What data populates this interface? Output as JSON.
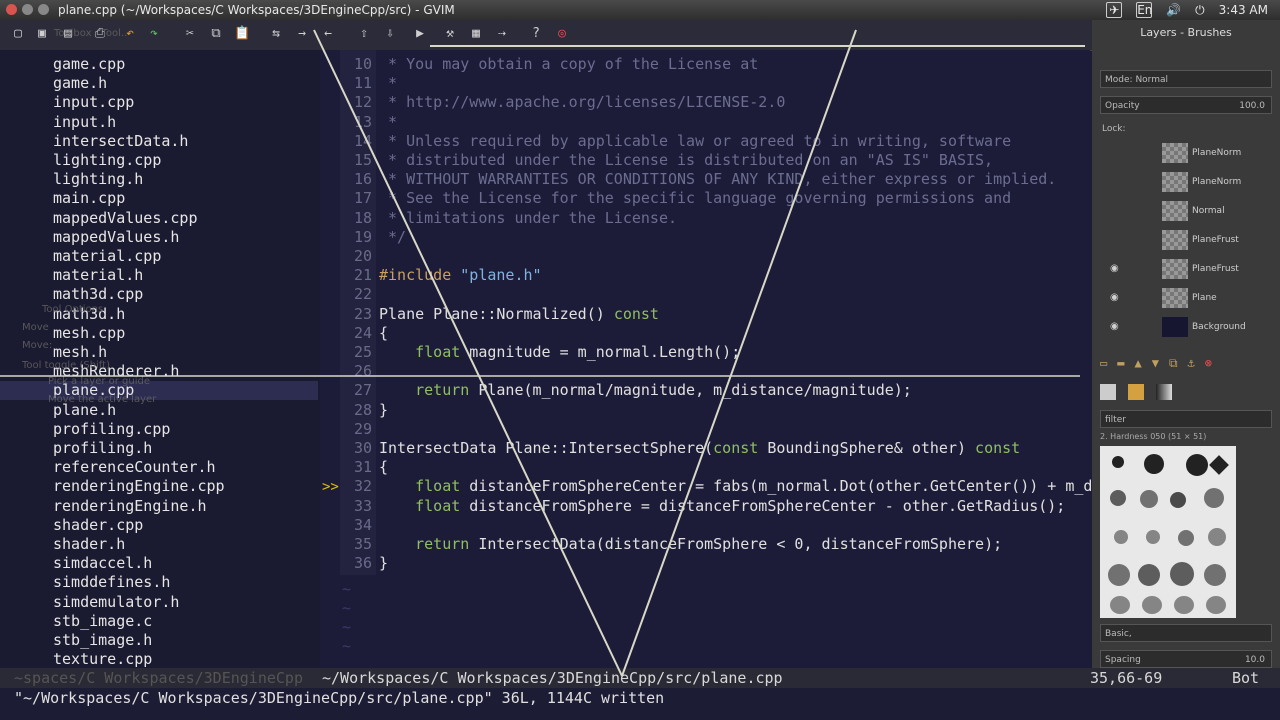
{
  "window": {
    "title": "plane.cpp (~/Workspaces/C Workspaces/3DEngineCpp/src) - GVIM"
  },
  "tray": {
    "lang": "En",
    "time": "3:43 AM"
  },
  "toolbar": {
    "icons": [
      "new-icon",
      "open-icon",
      "save-icon",
      "print-icon",
      "undo-icon",
      "redo-icon",
      "cut-icon",
      "copy-icon",
      "paste-icon",
      "replace-icon",
      "find-next-icon",
      "find-prev-icon",
      "load-session-icon",
      "save-session-icon",
      "run-script-icon",
      "make-icon",
      "run-ctags-icon",
      "jump-tag-icon",
      "help-icon",
      "find-help-icon"
    ]
  },
  "ghost_labels": [
    "Toolbox - Tool..",
    "Tool Options",
    "Move",
    "Move:",
    "Tool toggle (Shift)",
    "Pick a layer or guide",
    "Move the active layer"
  ],
  "files": [
    "game.cpp",
    "game.h",
    "input.cpp",
    "input.h",
    "intersectData.h",
    "lighting.cpp",
    "lighting.h",
    "main.cpp",
    "mappedValues.cpp",
    "mappedValues.h",
    "material.cpp",
    "material.h",
    "math3d.cpp",
    "math3d.h",
    "mesh.cpp",
    "mesh.h",
    "meshRenderer.h",
    "plane.cpp",
    "plane.h",
    "profiling.cpp",
    "profiling.h",
    "referenceCounter.h",
    "renderingEngine.cpp",
    "renderingEngine.h",
    "shader.cpp",
    "shader.h",
    "simdaccel.h",
    "simddefines.h",
    "simdemulator.h",
    "stb_image.c",
    "stb_image.h",
    "texture.cpp"
  ],
  "selected_file": "plane.cpp",
  "code_lines": [
    {
      "n": "10",
      "t": " * You may obtain a copy of the License at",
      "c": "cm"
    },
    {
      "n": "11",
      "t": " *",
      "c": "cm"
    },
    {
      "n": "12",
      "t": " * http://www.apache.org/licenses/LICENSE-2.0",
      "c": "cm"
    },
    {
      "n": "13",
      "t": " *",
      "c": "cm"
    },
    {
      "n": "14",
      "t": " * Unless required by applicable law or agreed to in writing, software",
      "c": "cm"
    },
    {
      "n": "15",
      "t": " * distributed under the License is distributed on an \"AS IS\" BASIS,",
      "c": "cm"
    },
    {
      "n": "16",
      "t": " * WITHOUT WARRANTIES OR CONDITIONS OF ANY KIND, either express or implied.",
      "c": "cm"
    },
    {
      "n": "17",
      "t": " * See the License for the specific language governing permissions and",
      "c": "cm"
    },
    {
      "n": "18",
      "t": " * limitations under the License.",
      "c": "cm"
    },
    {
      "n": "19",
      "t": " */",
      "c": "cm"
    },
    {
      "n": "20",
      "t": "",
      "c": ""
    },
    {
      "n": "21",
      "t": "#include \"plane.h\"",
      "c": "inc"
    },
    {
      "n": "22",
      "t": "",
      "c": ""
    },
    {
      "n": "23",
      "t": "Plane Plane::Normalized() const",
      "c": "fn"
    },
    {
      "n": "24",
      "t": "{",
      "c": ""
    },
    {
      "n": "25",
      "t": "    float magnitude = m_normal.Length();",
      "c": "fl"
    },
    {
      "n": "26",
      "t": "",
      "c": ""
    },
    {
      "n": "27",
      "t": "    return Plane(m_normal/magnitude, m_distance/magnitude);",
      "c": "rt"
    },
    {
      "n": "28",
      "t": "}",
      "c": ""
    },
    {
      "n": "29",
      "t": "",
      "c": ""
    },
    {
      "n": "30",
      "t": "IntersectData Plane::IntersectSphere(const BoundingSphere& other) const",
      "c": "fn2"
    },
    {
      "n": "31",
      "t": "{",
      "c": ""
    },
    {
      "n": "32",
      "t": "    float distanceFromSphereCenter = fabs(m_normal.Dot(other.GetCenter()) + m_distance);",
      "c": "fl"
    },
    {
      "n": "33",
      "t": "    float distanceFromSphere = distanceFromSphereCenter - other.GetRadius();",
      "c": "fl"
    },
    {
      "n": "34",
      "t": "",
      "c": ""
    },
    {
      "n": "35",
      "t": "    return IntersectData(distanceFromSphere < 0, distanceFromSphere);",
      "c": "rt"
    },
    {
      "n": "36",
      "t": "}",
      "c": ""
    }
  ],
  "sign_marker": ">>",
  "status": {
    "left": "~/Workspaces/C Workspaces/3DEngineCpp/src/plane.cpp",
    "ghost_left": "~spaces/C Workspaces/3DEngineCpp",
    "position": "35,66-69",
    "scroll": "Bot"
  },
  "command_line": "\"~/Workspaces/C Workspaces/3DEngineCpp/src/plane.cpp\" 36L, 1144C written",
  "layers_dock": {
    "title": "Layers - Brushes",
    "mode_label": "Mode:",
    "mode_value": "Normal",
    "opacity_label": "Opacity",
    "opacity_value": "100.0",
    "lock_label": "Lock:",
    "layers": [
      "PlaneNorm",
      "PlaneNorm",
      "Normal",
      "PlaneFrust",
      "PlaneFrust",
      "Plane",
      "Background"
    ]
  },
  "brushes_dock": {
    "filter": "filter",
    "brush_name": "2. Hardness 050 (51 × 51)",
    "preset": "Basic,",
    "spacing_label": "Spacing",
    "spacing_value": "10.0"
  },
  "colors": {
    "accent": "#3b7bd8",
    "editor_bg": "#1c1c38",
    "comment": "#6c6c90",
    "keyword": "#8fbf5f"
  }
}
